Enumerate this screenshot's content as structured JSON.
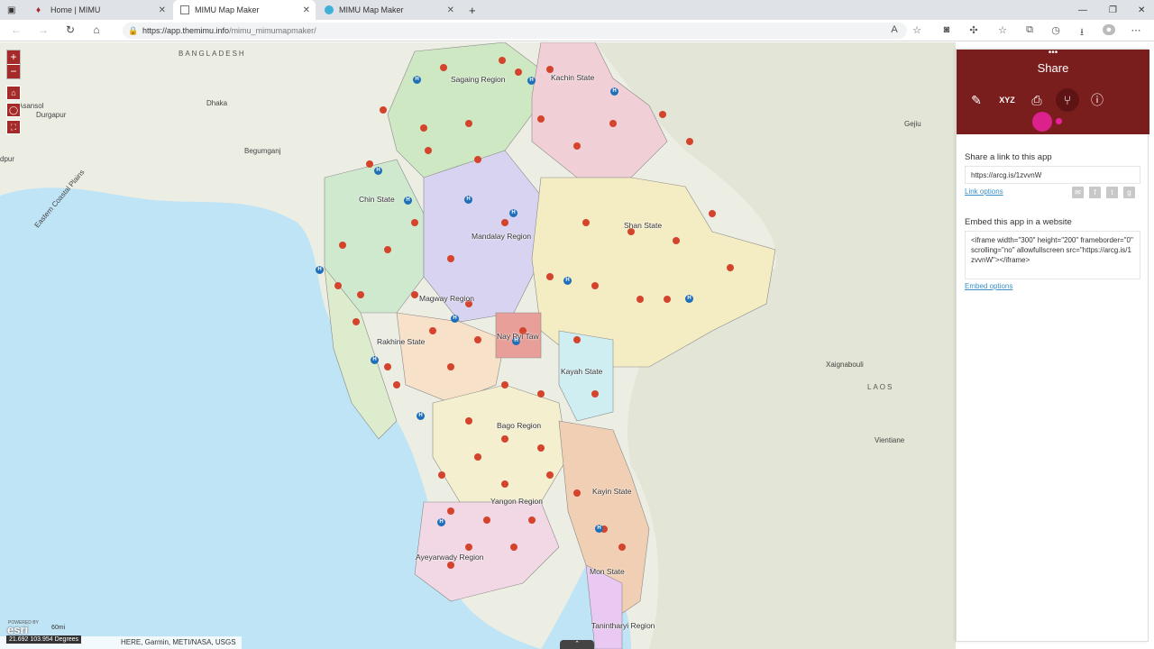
{
  "browser": {
    "tabs": [
      {
        "label": "Home | MIMU",
        "active": false
      },
      {
        "label": "MIMU Map Maker",
        "active": true
      },
      {
        "label": "MIMU Map Maker",
        "active": false
      }
    ],
    "url_host": "https://app.themimu.info",
    "url_path": "/mimu_mimumapmaker/"
  },
  "map": {
    "zoom_in": "+",
    "zoom_out": "−",
    "country_labels": [
      "BANGLADESH",
      "LAOS"
    ],
    "city_labels": [
      "Asansol",
      "Durgapur",
      "Dhaka",
      "Begumganj",
      "Gejiu",
      "Xaignabouli",
      "Vientiane",
      "Eastern Coastal Plains",
      "dpur"
    ],
    "region_labels": [
      "Sagaing Region",
      "Kachin State",
      "Chin State",
      "Mandalay Region",
      "Shan State",
      "Magway Region",
      "Nay Pyi Taw",
      "Rakhine State",
      "Kayah State",
      "Bago Region",
      "Yangon Region",
      "Kayin State",
      "Ayeyarwady Region",
      "Mon State",
      "Tanintharyi Region"
    ],
    "attribution": "HERE, Garmin, METI/NASA, USGS",
    "coordinates": "21.692 103.954 Degrees",
    "scale": "60mi",
    "esri_powered": "POWERED BY",
    "esri_logo": "esri"
  },
  "share_panel": {
    "title": "Share",
    "share_link_label": "Share a link to this app",
    "share_link_value": "https://arcg.is/1zvvnW",
    "link_options": "Link options",
    "embed_label": "Embed this app in a website",
    "embed_code": "<iframe width=\"300\" height=\"200\" frameborder=\"0\" scrolling=\"no\" allowfullscreen src=\"https://arcg.is/1zvvnW\"></iframe>",
    "embed_options": "Embed options",
    "accent_color": "#7a1d1d"
  }
}
